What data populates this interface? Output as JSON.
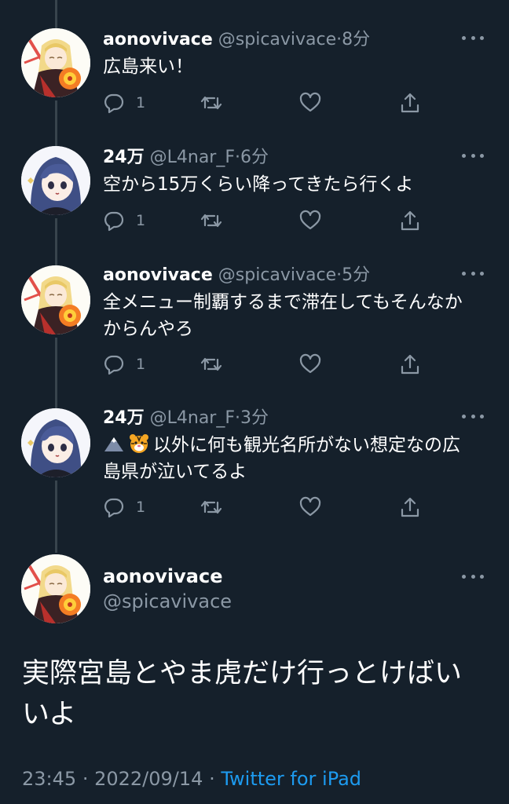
{
  "tweets": [
    {
      "name": "aonovivace",
      "handle": "@spicavivace",
      "time": "8分",
      "text": "広島来い！",
      "reply_count": "1"
    },
    {
      "name": "24万",
      "handle": "@L4nar_F",
      "time": "6分",
      "text": "空から15万くらい降ってきたら行くよ",
      "reply_count": "1"
    },
    {
      "name": "aonovivace",
      "handle": "@spicavivace",
      "time": "5分",
      "text_line1": "全メニュー制覇するまで滞在してもそんなか",
      "text_line2": "からんやろ",
      "reply_count": "1"
    },
    {
      "name": "24万",
      "handle": "@L4nar_F",
      "time": "3分",
      "text_line1": "以外に何も観光名所がない想定なの広",
      "text_line2": "島県が泣いてるよ",
      "reply_count": "1",
      "emoji": [
        "mountain-emoji",
        "tiger-face-emoji"
      ]
    }
  ],
  "main_tweet": {
    "name": "aonovivace",
    "handle": "@spicavivace",
    "text_line1": "実際宮島とやま虎だけ行っとけばい",
    "text_line2": "いよ",
    "time": "23:45",
    "date": "2022/09/14",
    "source": "Twitter for iPad",
    "separator": "·"
  },
  "colors": {
    "background": "#15202b",
    "secondary_text": "#8b98a5",
    "link": "#1d9bf0",
    "thread_line": "#38444d"
  },
  "icons": [
    "reply-icon",
    "retweet-icon",
    "like-icon",
    "share-icon",
    "more-icon"
  ]
}
